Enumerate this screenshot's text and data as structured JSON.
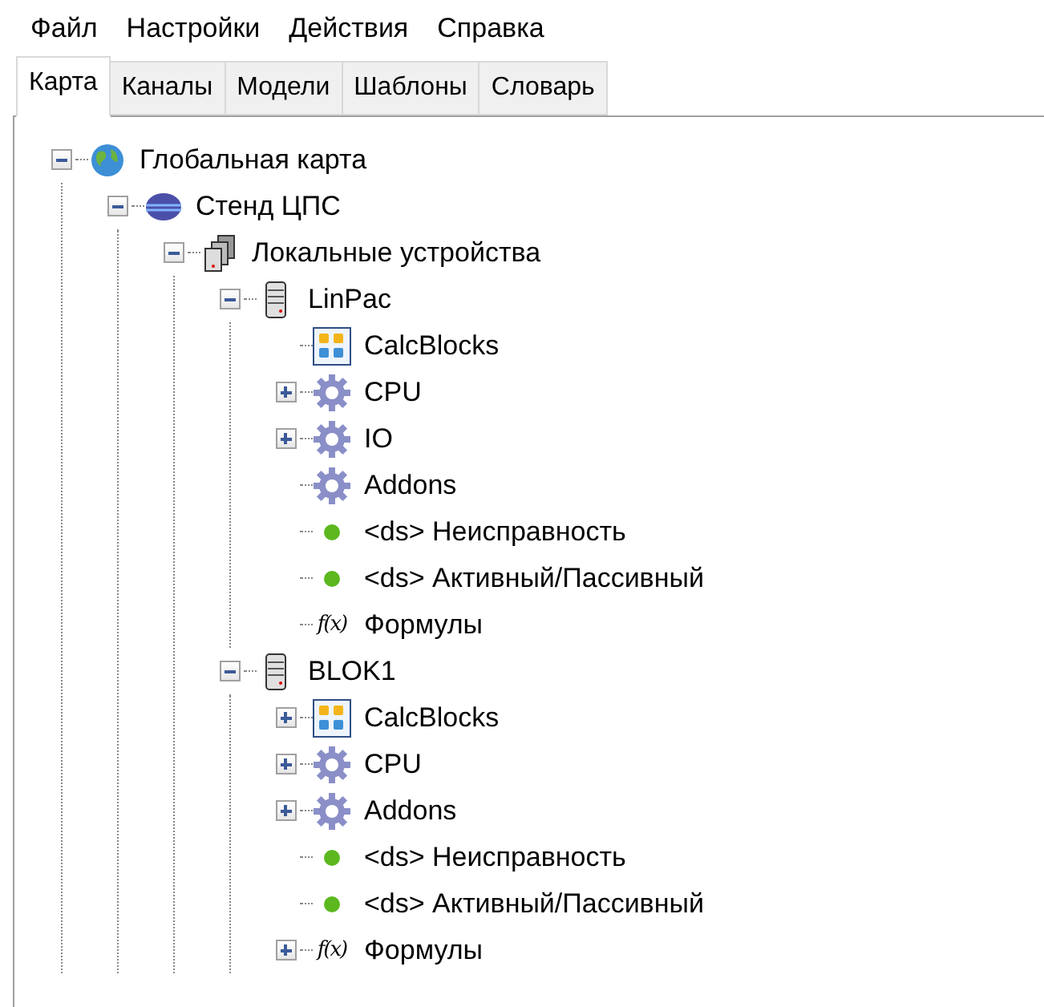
{
  "menu": [
    "Файл",
    "Настройки",
    "Действия",
    "Справка"
  ],
  "tabs": [
    {
      "label": "Карта",
      "selected": true
    },
    {
      "label": "Каналы",
      "selected": false
    },
    {
      "label": "Модели",
      "selected": false
    },
    {
      "label": "Шаблоны",
      "selected": false
    },
    {
      "label": "Словарь",
      "selected": false
    }
  ],
  "tree": [
    {
      "kind": "globe",
      "label": "Глобальная карта",
      "expanded": true,
      "children": [
        {
          "kind": "network",
          "label": "Стенд ЦПС",
          "expanded": true,
          "children": [
            {
              "kind": "servers",
              "label": "Локальные устройства",
              "expanded": true,
              "children": [
                {
                  "kind": "server",
                  "label": "LinPac",
                  "expanded": true,
                  "children": [
                    {
                      "kind": "blocks",
                      "label": "CalcBlocks"
                    },
                    {
                      "kind": "gear",
                      "label": "CPU",
                      "expanded": false
                    },
                    {
                      "kind": "gear",
                      "label": "IO",
                      "expanded": false
                    },
                    {
                      "kind": "gear",
                      "label": "Addons"
                    },
                    {
                      "kind": "dot",
                      "label": "<ds> Неисправность",
                      "color": "#5cb81e"
                    },
                    {
                      "kind": "dot",
                      "label": "<ds> Активный/Пассивный",
                      "color": "#5cb81e"
                    },
                    {
                      "kind": "formula",
                      "icon_text": "f(x)",
                      "label": "Формулы"
                    }
                  ]
                },
                {
                  "kind": "server",
                  "label": "BLOK1",
                  "expanded": true,
                  "children": [
                    {
                      "kind": "blocks",
                      "label": "CalcBlocks",
                      "expanded": false
                    },
                    {
                      "kind": "gear",
                      "label": "CPU",
                      "expanded": false
                    },
                    {
                      "kind": "gear",
                      "label": "Addons",
                      "expanded": false
                    },
                    {
                      "kind": "dot",
                      "label": "<ds> Неисправность",
                      "color": "#5cb81e"
                    },
                    {
                      "kind": "dot",
                      "label": "<ds> Активный/Пассивный",
                      "color": "#5cb81e"
                    },
                    {
                      "kind": "formula",
                      "icon_text": "f(x)",
                      "label": "Формулы",
                      "expanded": false
                    }
                  ]
                }
              ]
            }
          ]
        }
      ]
    }
  ]
}
